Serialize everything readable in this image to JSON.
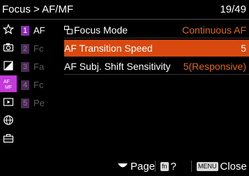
{
  "header": {
    "path": "Focus > AF/MF",
    "page": "19/49"
  },
  "colors": {
    "accent": "#d9490f",
    "value": "#e06a17",
    "tab": "#c23ad9"
  },
  "categories": [
    {
      "name": "star-icon"
    },
    {
      "name": "camera-icon"
    },
    {
      "name": "exposure-icon"
    },
    {
      "name": "af-mf-icon"
    },
    {
      "name": "playback-icon"
    },
    {
      "name": "network-icon"
    },
    {
      "name": "toolbox-icon"
    }
  ],
  "subtabs": [
    {
      "num": "1",
      "text": "AF"
    },
    {
      "num": "2",
      "text": "Fc"
    },
    {
      "num": "3",
      "text": "Fa"
    },
    {
      "num": "4",
      "text": "Fc"
    },
    {
      "num": "5",
      "text": "Pe"
    }
  ],
  "menu": [
    {
      "label": "Focus Mode",
      "value": "Continuous AF"
    },
    {
      "label": "AF Transition Speed",
      "value": "5"
    },
    {
      "label": "AF Subj. Shift Sensitivity",
      "value": "5(Responsive)"
    }
  ],
  "footer": {
    "page_label": "Page",
    "help_label": "?",
    "close_label": "Close",
    "help_key": "fn",
    "close_key": "MENU"
  }
}
